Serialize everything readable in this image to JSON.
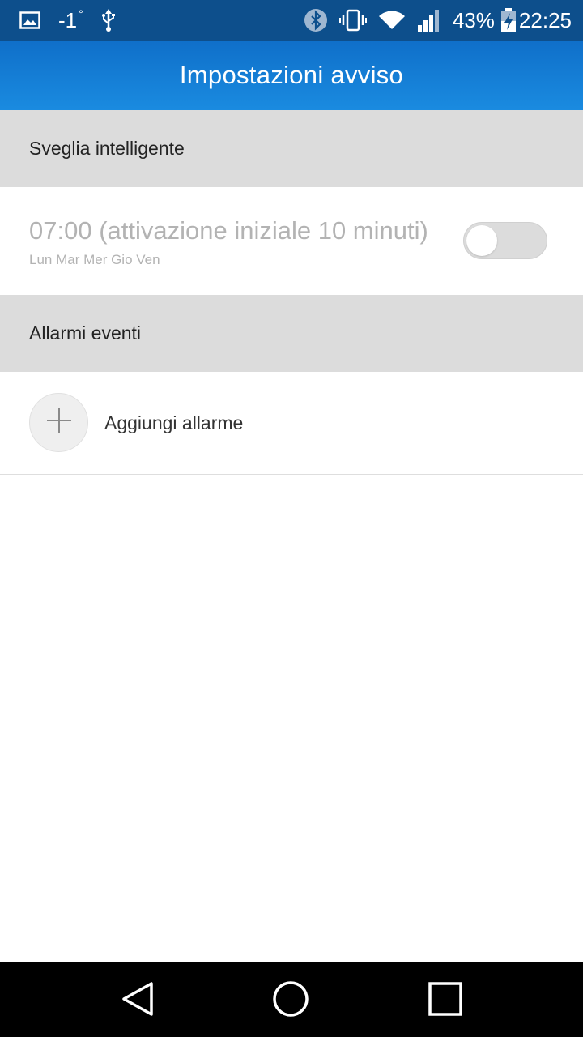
{
  "status_bar": {
    "temperature": "-1",
    "temperature_unit": "°",
    "battery_percent": "43%",
    "time": "22:25",
    "icons": [
      "gallery-icon",
      "usb-icon",
      "bluetooth-icon",
      "vibrate-icon",
      "wifi-icon",
      "signal-icon",
      "battery-charging-icon"
    ],
    "background_color": "#0d4f8c"
  },
  "app_bar": {
    "title": "Impostazioni avviso",
    "color": "#1a8be0"
  },
  "smart_alarm": {
    "section_title": "Sveglia intelligente",
    "alarm": {
      "time_text": "07:00 (attivazione iniziale 10 minuti)",
      "days": "Lun Mar Mer Gio Ven",
      "enabled": false
    }
  },
  "event_alarms": {
    "section_title": "Allarmi eventi",
    "add_label": "Aggiungi allarme",
    "add_icon": "plus-icon"
  },
  "nav_bar": {
    "icons": [
      "back-icon",
      "home-icon",
      "recents-icon"
    ]
  }
}
